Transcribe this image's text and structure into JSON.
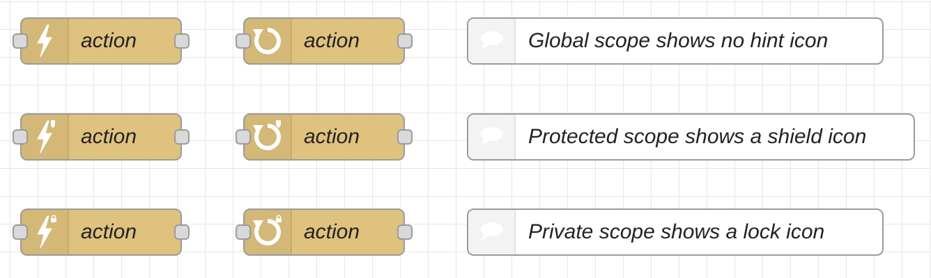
{
  "rows": [
    {
      "scope": "global",
      "inject_node": {
        "icon": "inject-lightning-icon",
        "badge": "none",
        "label": "action"
      },
      "trigger_node": {
        "icon": "trigger-refresh-icon",
        "badge": "none",
        "label": "action"
      },
      "comment": {
        "icon": "comment-speech-bubble-icon",
        "text": "Global scope shows no hint icon"
      }
    },
    {
      "scope": "protected",
      "inject_node": {
        "icon": "inject-lightning-icon",
        "badge": "shield-icon",
        "label": "action"
      },
      "trigger_node": {
        "icon": "trigger-refresh-icon",
        "badge": "shield-icon",
        "label": "action"
      },
      "comment": {
        "icon": "comment-speech-bubble-icon",
        "text": "Protected scope shows a shield icon"
      }
    },
    {
      "scope": "private",
      "inject_node": {
        "icon": "inject-lightning-icon",
        "badge": "lock-icon",
        "label": "action"
      },
      "trigger_node": {
        "icon": "trigger-refresh-icon",
        "badge": "lock-icon",
        "label": "action"
      },
      "comment": {
        "icon": "comment-speech-bubble-icon",
        "text": "Private scope shows a lock icon"
      }
    }
  ],
  "colors": {
    "canvas_background": "#ffffff",
    "grid_line": "#e6e6e6",
    "action_node_fill": "#dfc27e",
    "node_border": "#9b9b9b",
    "port_fill": "#d9d9d9",
    "comment_fill": "#ffffff",
    "icon_white": "#ffffff"
  }
}
